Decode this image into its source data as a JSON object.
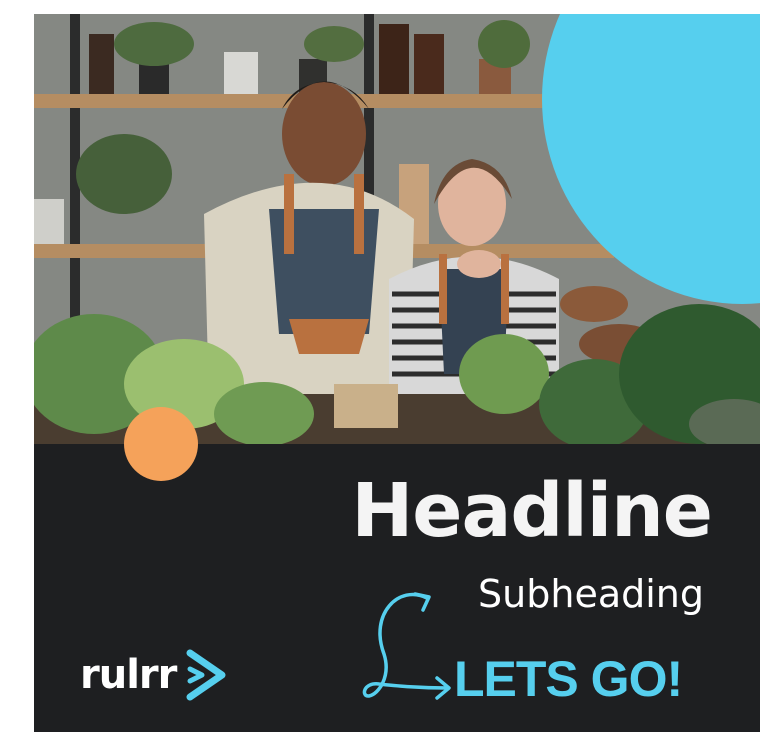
{
  "ad": {
    "headline": "Headline",
    "subheading": "Subheading",
    "cta_label": "LETS GO!",
    "brand": "rulrr",
    "colors": {
      "background": "#1e1f21",
      "accent_blue": "#56cfee",
      "accent_orange": "#f5a25a",
      "text": "#ffffff"
    },
    "icons": {
      "logo_mark": "chevron-arrow-icon",
      "cta_arrow": "curly-arrow-icon"
    }
  }
}
